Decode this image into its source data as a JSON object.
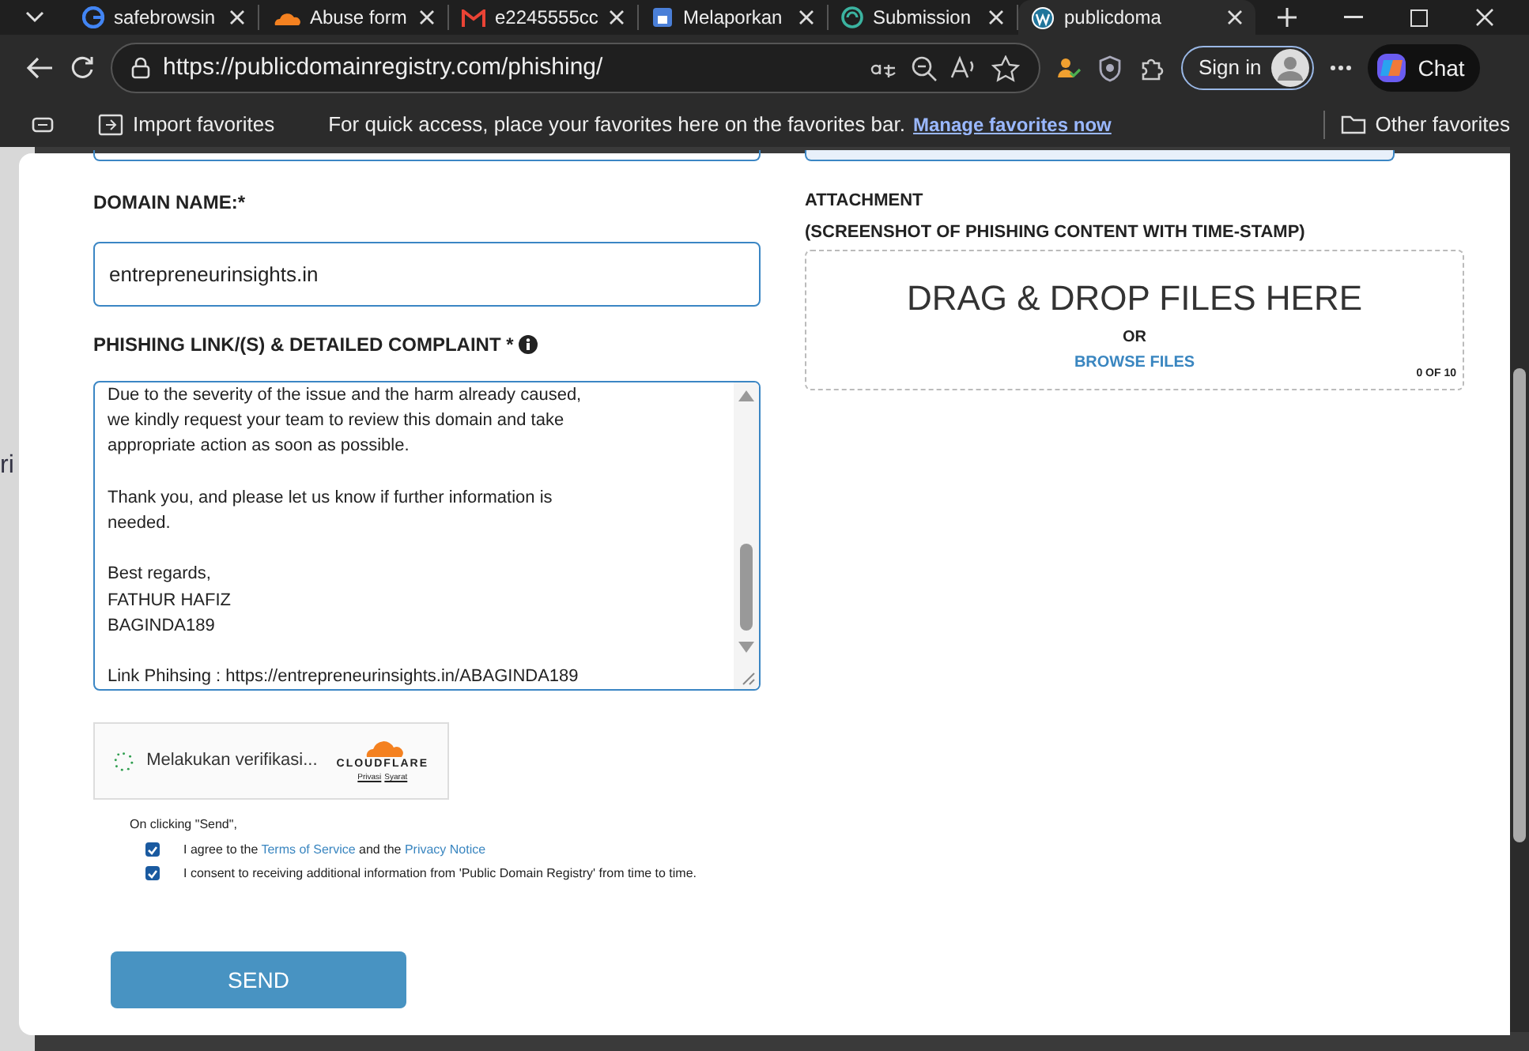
{
  "tabs": [
    {
      "label": "safebrowsin",
      "selected": false
    },
    {
      "label": "Abuse form",
      "selected": false
    },
    {
      "label": "e2245555cc",
      "selected": false
    },
    {
      "label": "Melaporkan",
      "selected": false
    },
    {
      "label": "Submission",
      "selected": false
    },
    {
      "label": "publicdoma",
      "selected": true
    }
  ],
  "address_bar": {
    "url": "https://publicdomainregistry.com/phishing/",
    "sign_in": "Sign in",
    "chat": "Chat"
  },
  "favorites_bar": {
    "import": "Import favorites",
    "hint": "For quick access, place your favorites here on the favorites bar.",
    "manage_link": "Manage favorites now",
    "other": "Other favorites"
  },
  "background_page_text": "ri",
  "form": {
    "domain_label": "DOMAIN NAME:*",
    "domain_value": "entrepreneurinsights.in",
    "complaint_label": "PHISHING LINK/(S) & DETAILED COMPLAINT *",
    "complaint_paragraphs": [
      [
        "Due to the severity of the issue and the harm already caused,",
        "we kindly request your team to review this domain and take",
        "appropriate action as soon as possible."
      ],
      [
        "Thank you, and please let us know if further information is",
        "needed."
      ],
      [
        "Best regards,",
        "FATHUR HAFIZ",
        "BAGINDA189"
      ],
      [
        "Link Phihsing : https://entrepreneurinsights.in/ABAGINDA189"
      ]
    ],
    "attachment_label": "ATTACHMENT",
    "attachment_sub": "(SCREENSHOT OF PHISHING CONTENT WITH TIME-STAMP)",
    "drop_title": "DRAG & DROP FILES HERE",
    "drop_or": "OR",
    "browse": "BROWSE FILES",
    "file_count": "0 OF 10",
    "captcha": {
      "status": "Melakukan verifikasi...",
      "brand": "CLOUDFLARE",
      "privacy": "Privasi",
      "terms": "Syarat"
    },
    "on_clicking": "On clicking \"Send\",",
    "consents": [
      {
        "parts": [
          {
            "kind": "text",
            "text": "I agree to the "
          },
          {
            "kind": "link",
            "text": "Terms of Service"
          },
          {
            "kind": "text",
            "text": " and the "
          },
          {
            "kind": "link",
            "text": "Privacy Notice"
          }
        ],
        "checked": true
      },
      {
        "parts": [
          {
            "kind": "text",
            "text": "I consent to receiving additional information from 'Public Domain Registry' from time to time."
          }
        ],
        "checked": true
      }
    ],
    "send": "SEND"
  }
}
